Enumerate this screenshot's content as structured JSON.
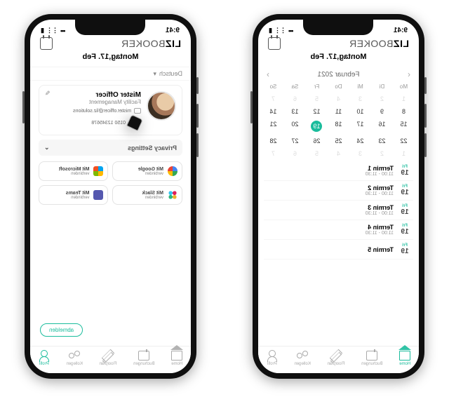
{
  "status": {
    "time": "9:41",
    "signal": "•••",
    "wifi": "⋮⋮",
    "batt": "▮"
  },
  "brand": {
    "b1": "LIZ",
    "b2": "BOOKER"
  },
  "sub_date": "Montag,17. Feb",
  "nav": {
    "items": [
      {
        "label": "Home"
      },
      {
        "label": "Buchungen"
      },
      {
        "label": "Floorplan"
      },
      {
        "label": "Kollegen"
      },
      {
        "label": "Profil"
      }
    ]
  },
  "left": {
    "month": "Februar 2021",
    "daynames": [
      "Mo",
      "Di",
      "Mi",
      "Do",
      "Fr",
      "Sa",
      "So"
    ],
    "weeks": [
      [
        "1",
        "2",
        "3",
        "4",
        "5",
        "6",
        "7"
      ],
      [
        "8",
        "9",
        "10",
        "11",
        "12",
        "13",
        "14"
      ],
      [
        "15",
        "16",
        "17",
        "18",
        "19",
        "20",
        "21"
      ],
      [
        "22",
        "23",
        "24",
        "25",
        "26",
        "27",
        "28"
      ],
      [
        "1",
        "2",
        "3",
        "4",
        "5",
        "6",
        "7"
      ]
    ],
    "today_index": [
      2,
      4
    ],
    "dim_rows": [
      0,
      4
    ],
    "events": [
      {
        "wd": "Fri",
        "dn": "19",
        "title": "Termin 1",
        "time": "11:00 - 11:30"
      },
      {
        "wd": "Fri",
        "dn": "19",
        "title": "Termin 2",
        "time": "11:00 - 11:30"
      },
      {
        "wd": "Fri",
        "dn": "19",
        "title": "Termin 3",
        "time": "11:00 - 11:30"
      },
      {
        "wd": "Fri",
        "dn": "19",
        "title": "Termin 4",
        "time": "11:00 - 11:30"
      },
      {
        "wd": "Fri",
        "dn": "19",
        "title": "Termin 5",
        "time": ""
      }
    ]
  },
  "right": {
    "lang": "Deutsch",
    "name": "Mister Officer",
    "role": "Facility Management",
    "email": "mister.officer@liz.solutions",
    "phone": "0150 12345678",
    "privacy": "Privacy Settings",
    "integrations": [
      {
        "label": "Mit Google",
        "sub": "verbinden"
      },
      {
        "label": "Mit Microsoft",
        "sub": "verbinden"
      },
      {
        "label": "Mit Slack",
        "sub": "verbinden"
      },
      {
        "label": "Mit Teams",
        "sub": "verbinden"
      }
    ],
    "logout": "abmelden"
  }
}
